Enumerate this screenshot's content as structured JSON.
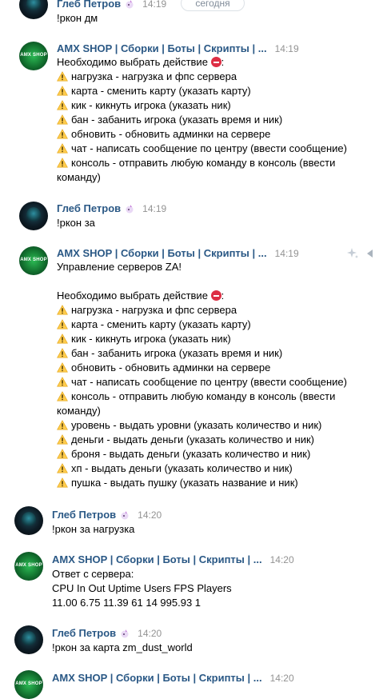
{
  "day_separator": "сегодня",
  "messages": [
    {
      "author": "Глеб Петров",
      "time": "14:19",
      "avatar": "gleb-avatar",
      "lines": [
        "!ркон дм"
      ]
    },
    {
      "author": "AMX SHOP | Сборки | Боты | Скрипты | ...",
      "time": "14:19",
      "avatar": "amx-shop-avatar",
      "intro": "Необходимо выбрать действие",
      "lines": [
        "нагрузка - нагрузка и фпс сервера",
        "карта - сменить карту (указать карту)",
        "кик - кикнуть игрока (указать ник)",
        "бан - забанить игрока (указать время и ник)",
        "обновить - обновить админки на сервере",
        "чат - написать сообщение по центру (ввести сообщение)",
        "консоль - отправить любую команду в консоль (ввести",
        "команду)"
      ]
    },
    {
      "author": "Глеб Петров",
      "time": "14:19",
      "avatar": "gleb-avatar",
      "lines": [
        "!ркон за"
      ]
    },
    {
      "author": "AMX SHOP | Сборки | Боты | Скрипты | ...",
      "time": "14:19",
      "avatar": "amx-shop-avatar",
      "title": "Управление серверов ZA!",
      "intro": "Необходимо выбрать действие",
      "lines": [
        "нагрузка - нагрузка и фпс сервера",
        "карта - сменить карту (указать карту)",
        "кик - кикнуть игрока (указать ник)",
        "бан - забанить игрока (указать время и ник)",
        "обновить - обновить админки на сервере",
        "чат - написать сообщение по центру (ввести сообщение)",
        "консоль - отправить любую команду в консоль (ввести",
        "команду)",
        "уровень - выдать уровни (указать количество и ник)",
        "деньги - выдать деньги (указать количество и ник)",
        "броня - выдать деньги (указать количество и ник)",
        "хп - выдать деньги (указать количество и ник)",
        "пушка - выдать пушку (указать название и ник)"
      ]
    },
    {
      "author": "Глеб Петров",
      "time": "14:20",
      "avatar": "gleb-avatar",
      "lines": [
        "!ркон за нагрузка"
      ]
    },
    {
      "author": "AMX SHOP | Сборки | Боты | Скрипты | ...",
      "time": "14:20",
      "avatar": "amx-shop-avatar",
      "lines": [
        "Ответ с сервера:",
        "CPU In Out Uptime Users FPS Players",
        "11.00 6.75 11.39 61 14 995.93 1"
      ]
    },
    {
      "author": "Глеб Петров",
      "time": "14:20",
      "avatar": "gleb-avatar",
      "lines": [
        "!ркон за карта zm_dust_world"
      ]
    },
    {
      "author": "AMX SHOP | Сборки | Боты | Скрипты | ...",
      "time": "14:20",
      "avatar": "amx-shop-avatar",
      "lines": []
    }
  ],
  "amx_avatar_text": "AMX SHOP",
  "colors": {
    "author": "#2a5885",
    "time": "#939393",
    "text": "#000000",
    "warning": "#ffcc4d",
    "stop": "#dd2e44"
  }
}
